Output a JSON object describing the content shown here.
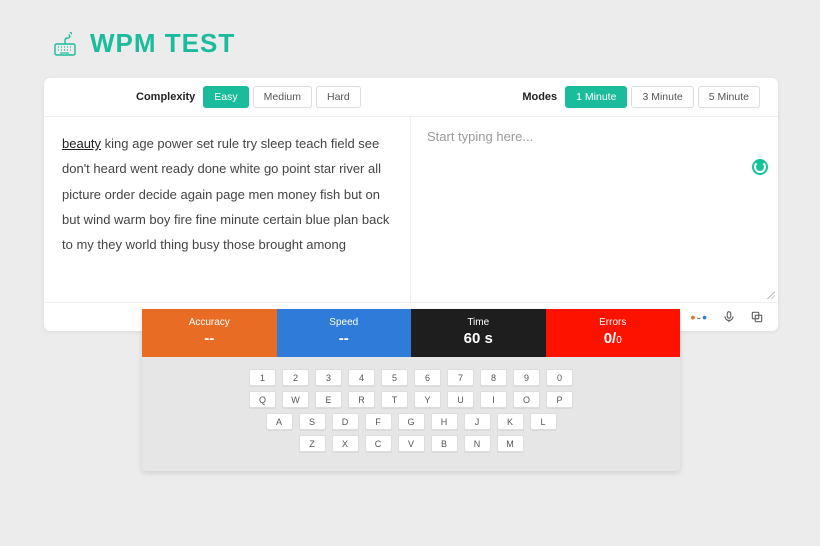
{
  "logo": {
    "text": "WPM TEST"
  },
  "toolbar": {
    "complexity_label": "Complexity",
    "complexity": [
      "Easy",
      "Medium",
      "Hard"
    ],
    "complexity_active": 0,
    "modes_label": "Modes",
    "modes": [
      "1 Minute",
      "3 Minute",
      "5 Minute"
    ],
    "modes_active": 0
  },
  "text": {
    "first_word": "beauty",
    "rest": " king age power set rule try sleep teach field see don't heard went ready done white go point star river all picture order decide again page men money fish but on but wind warm boy fire fine minute certain blue plan back to my they world thing busy those brought among"
  },
  "input": {
    "placeholder": "Start typing here..."
  },
  "stats": {
    "accuracy": {
      "label": "Accuracy",
      "value": "--"
    },
    "speed": {
      "label": "Speed",
      "value": "--"
    },
    "time": {
      "label": "Time",
      "value": "60 s"
    },
    "errors": {
      "label": "Errors",
      "value": "0/",
      "sub": "0"
    }
  },
  "keyboard": {
    "row1": [
      "1",
      "2",
      "3",
      "4",
      "5",
      "6",
      "7",
      "8",
      "9",
      "0"
    ],
    "row2": [
      "Q",
      "W",
      "E",
      "R",
      "T",
      "Y",
      "U",
      "I",
      "O",
      "P"
    ],
    "row3": [
      "A",
      "S",
      "D",
      "F",
      "G",
      "H",
      "J",
      "K",
      "L"
    ],
    "row4": [
      "Z",
      "X",
      "C",
      "V",
      "B",
      "N",
      "M"
    ]
  }
}
